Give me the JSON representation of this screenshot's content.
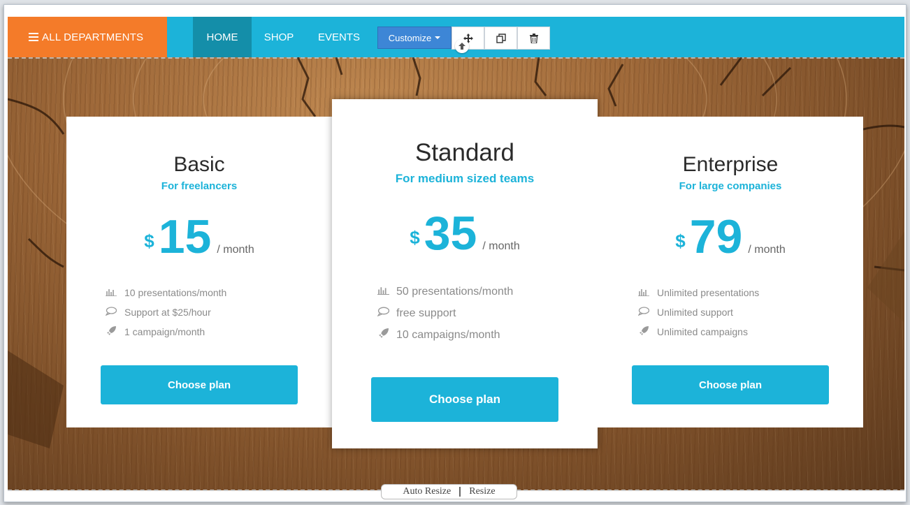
{
  "nav": {
    "all_departments": "ALL DEPARTMENTS",
    "links": [
      "HOME",
      "SHOP",
      "EVENTS"
    ],
    "active": "HOME"
  },
  "toolbar": {
    "customize_label": "Customize",
    "move_icon": "move-icon",
    "copy_icon": "copy-icon",
    "trash_icon": "trash-icon"
  },
  "plans": [
    {
      "name": "Basic",
      "subtitle": "For freelancers",
      "currency": "$",
      "price": "15",
      "period": "/ month",
      "features": [
        {
          "icon": "bar-chart-icon",
          "text": "10 presentations/month"
        },
        {
          "icon": "comment-icon",
          "text": "Support at $25/hour"
        },
        {
          "icon": "rocket-icon",
          "text": "1 campaign/month"
        }
      ],
      "button": "Choose plan"
    },
    {
      "name": "Standard",
      "subtitle": "For medium sized teams",
      "currency": "$",
      "price": "35",
      "period": "/ month",
      "features": [
        {
          "icon": "bar-chart-icon",
          "text": "50 presentations/month"
        },
        {
          "icon": "comment-icon",
          "text": "free support"
        },
        {
          "icon": "rocket-icon",
          "text": "10 campaigns/month"
        }
      ],
      "button": "Choose plan"
    },
    {
      "name": "Enterprise",
      "subtitle": "For large companies",
      "currency": "$",
      "price": "79",
      "period": "/ month",
      "features": [
        {
          "icon": "bar-chart-icon",
          "text": "Unlimited presentations"
        },
        {
          "icon": "comment-icon",
          "text": "Unlimited support"
        },
        {
          "icon": "rocket-icon",
          "text": "Unlimited campaigns"
        }
      ],
      "button": "Choose plan"
    }
  ],
  "resize": {
    "auto_label": "Auto Resize",
    "resize_label": "Resize"
  },
  "colors": {
    "accent": "#1cb3d9",
    "orange": "#f47b29",
    "customize": "#3d86d6"
  }
}
